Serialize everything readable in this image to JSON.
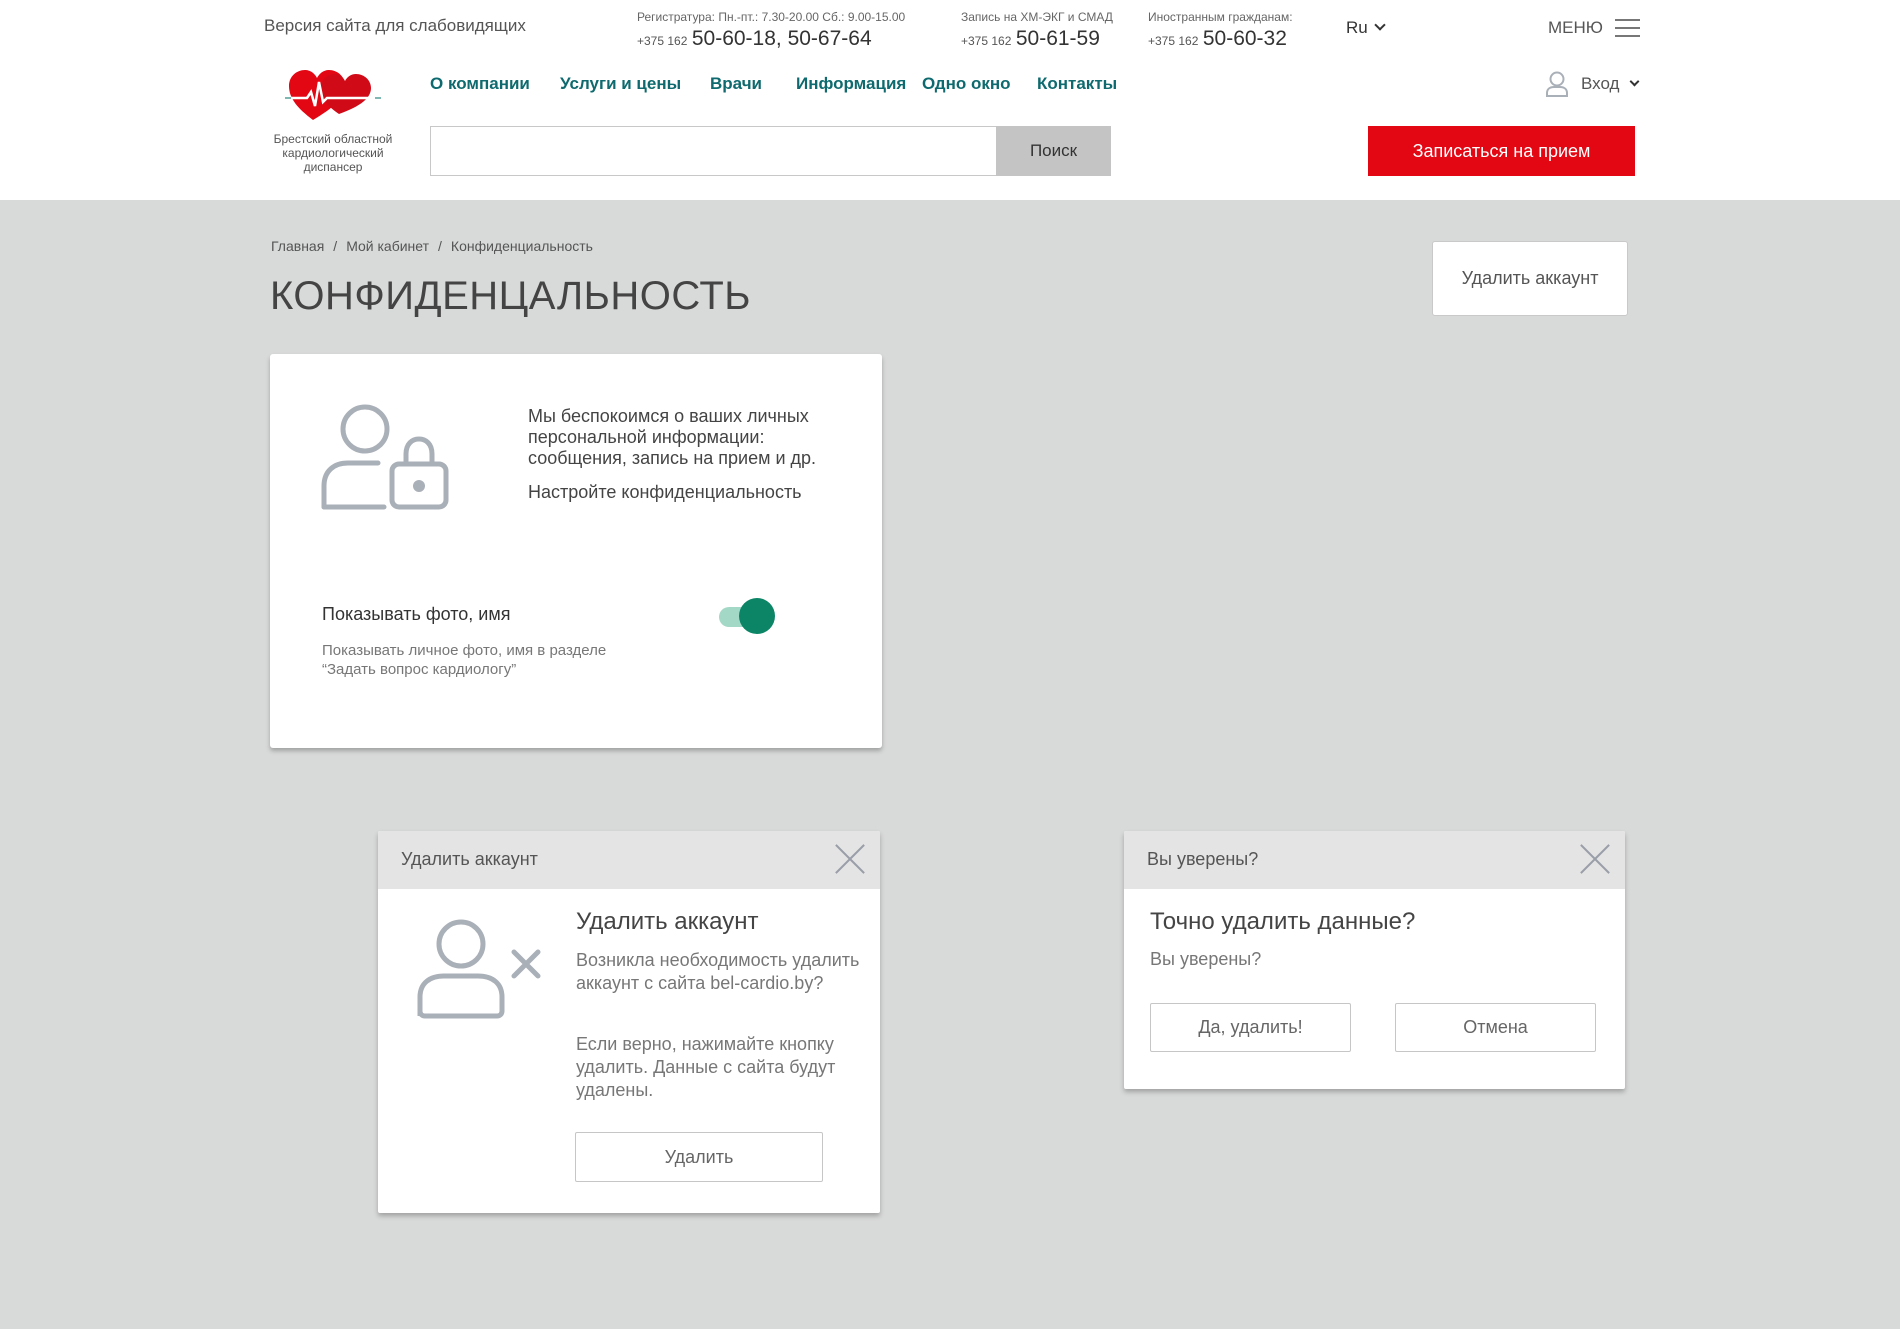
{
  "header": {
    "low_vision_link": "Версия сайта для слабовидящих",
    "phones": [
      {
        "label": "Регистратура: Пн.-пт.: 7.30-20.00 Сб.: 9.00-15.00",
        "prefix": "+375 162",
        "number": "50-60-18, 50-67-64"
      },
      {
        "label": "Запись на ХМ-ЭКГ и СМАД",
        "prefix": "+375 162",
        "number": "50-61-59"
      },
      {
        "label": "Иностранным гражданам:",
        "prefix": "+375 162",
        "number": "50-60-32"
      }
    ],
    "language": "Ru",
    "menu_label": "МЕНЮ",
    "logo_text": "Брестский областной кардиологический диспансер",
    "nav": [
      "О компании",
      "Услуги и цены",
      "Врачи",
      "Информация",
      "Одно окно",
      "Контакты"
    ],
    "login_label": "Вход",
    "search": {
      "value": "",
      "placeholder": "",
      "button": "Поиск"
    },
    "appointment_button": "Записаться на прием"
  },
  "colors": {
    "accent_red": "#e30613",
    "nav_teal": "#0e6a6e",
    "toggle_green": "#0b8566",
    "background": "#d8d9d9"
  },
  "breadcrumb": [
    "Главная",
    "Мой кабинет",
    "Конфиденциальность"
  ],
  "page_title": "КОНФИДЕНЦАЛЬНОСТЬ",
  "delete_account_button": "Удалить аккаунт",
  "privacy_card": {
    "icon": "user-lock-icon",
    "description": "Мы беспокоимся о ваших личных персональной информации: сообщения,  запись на прием и др.",
    "subtitle": "Настройте конфиденциальность",
    "setting_label": "Показывать фото, имя",
    "setting_description": "Показывать личное фото, имя в разделе “Задать вопрос кардиологу”",
    "setting_enabled": true
  },
  "delete_dialog": {
    "header": "Удалить аккаунт",
    "icon": "user-remove-icon",
    "title": "Удалить аккаунт",
    "paragraph1": "Возникла необходимость удалить аккаунт с сайта bel-cardio.by?",
    "paragraph2": "Если верно, нажимайте кнопку удалить. Данные с сайта будут удалены.",
    "button": "Удалить"
  },
  "confirm_dialog": {
    "header": "Вы уверены?",
    "title": "Точно удалить данные?",
    "subtitle": "Вы уверены?",
    "confirm_button": "Да, удалить!",
    "cancel_button": "Отмена"
  }
}
